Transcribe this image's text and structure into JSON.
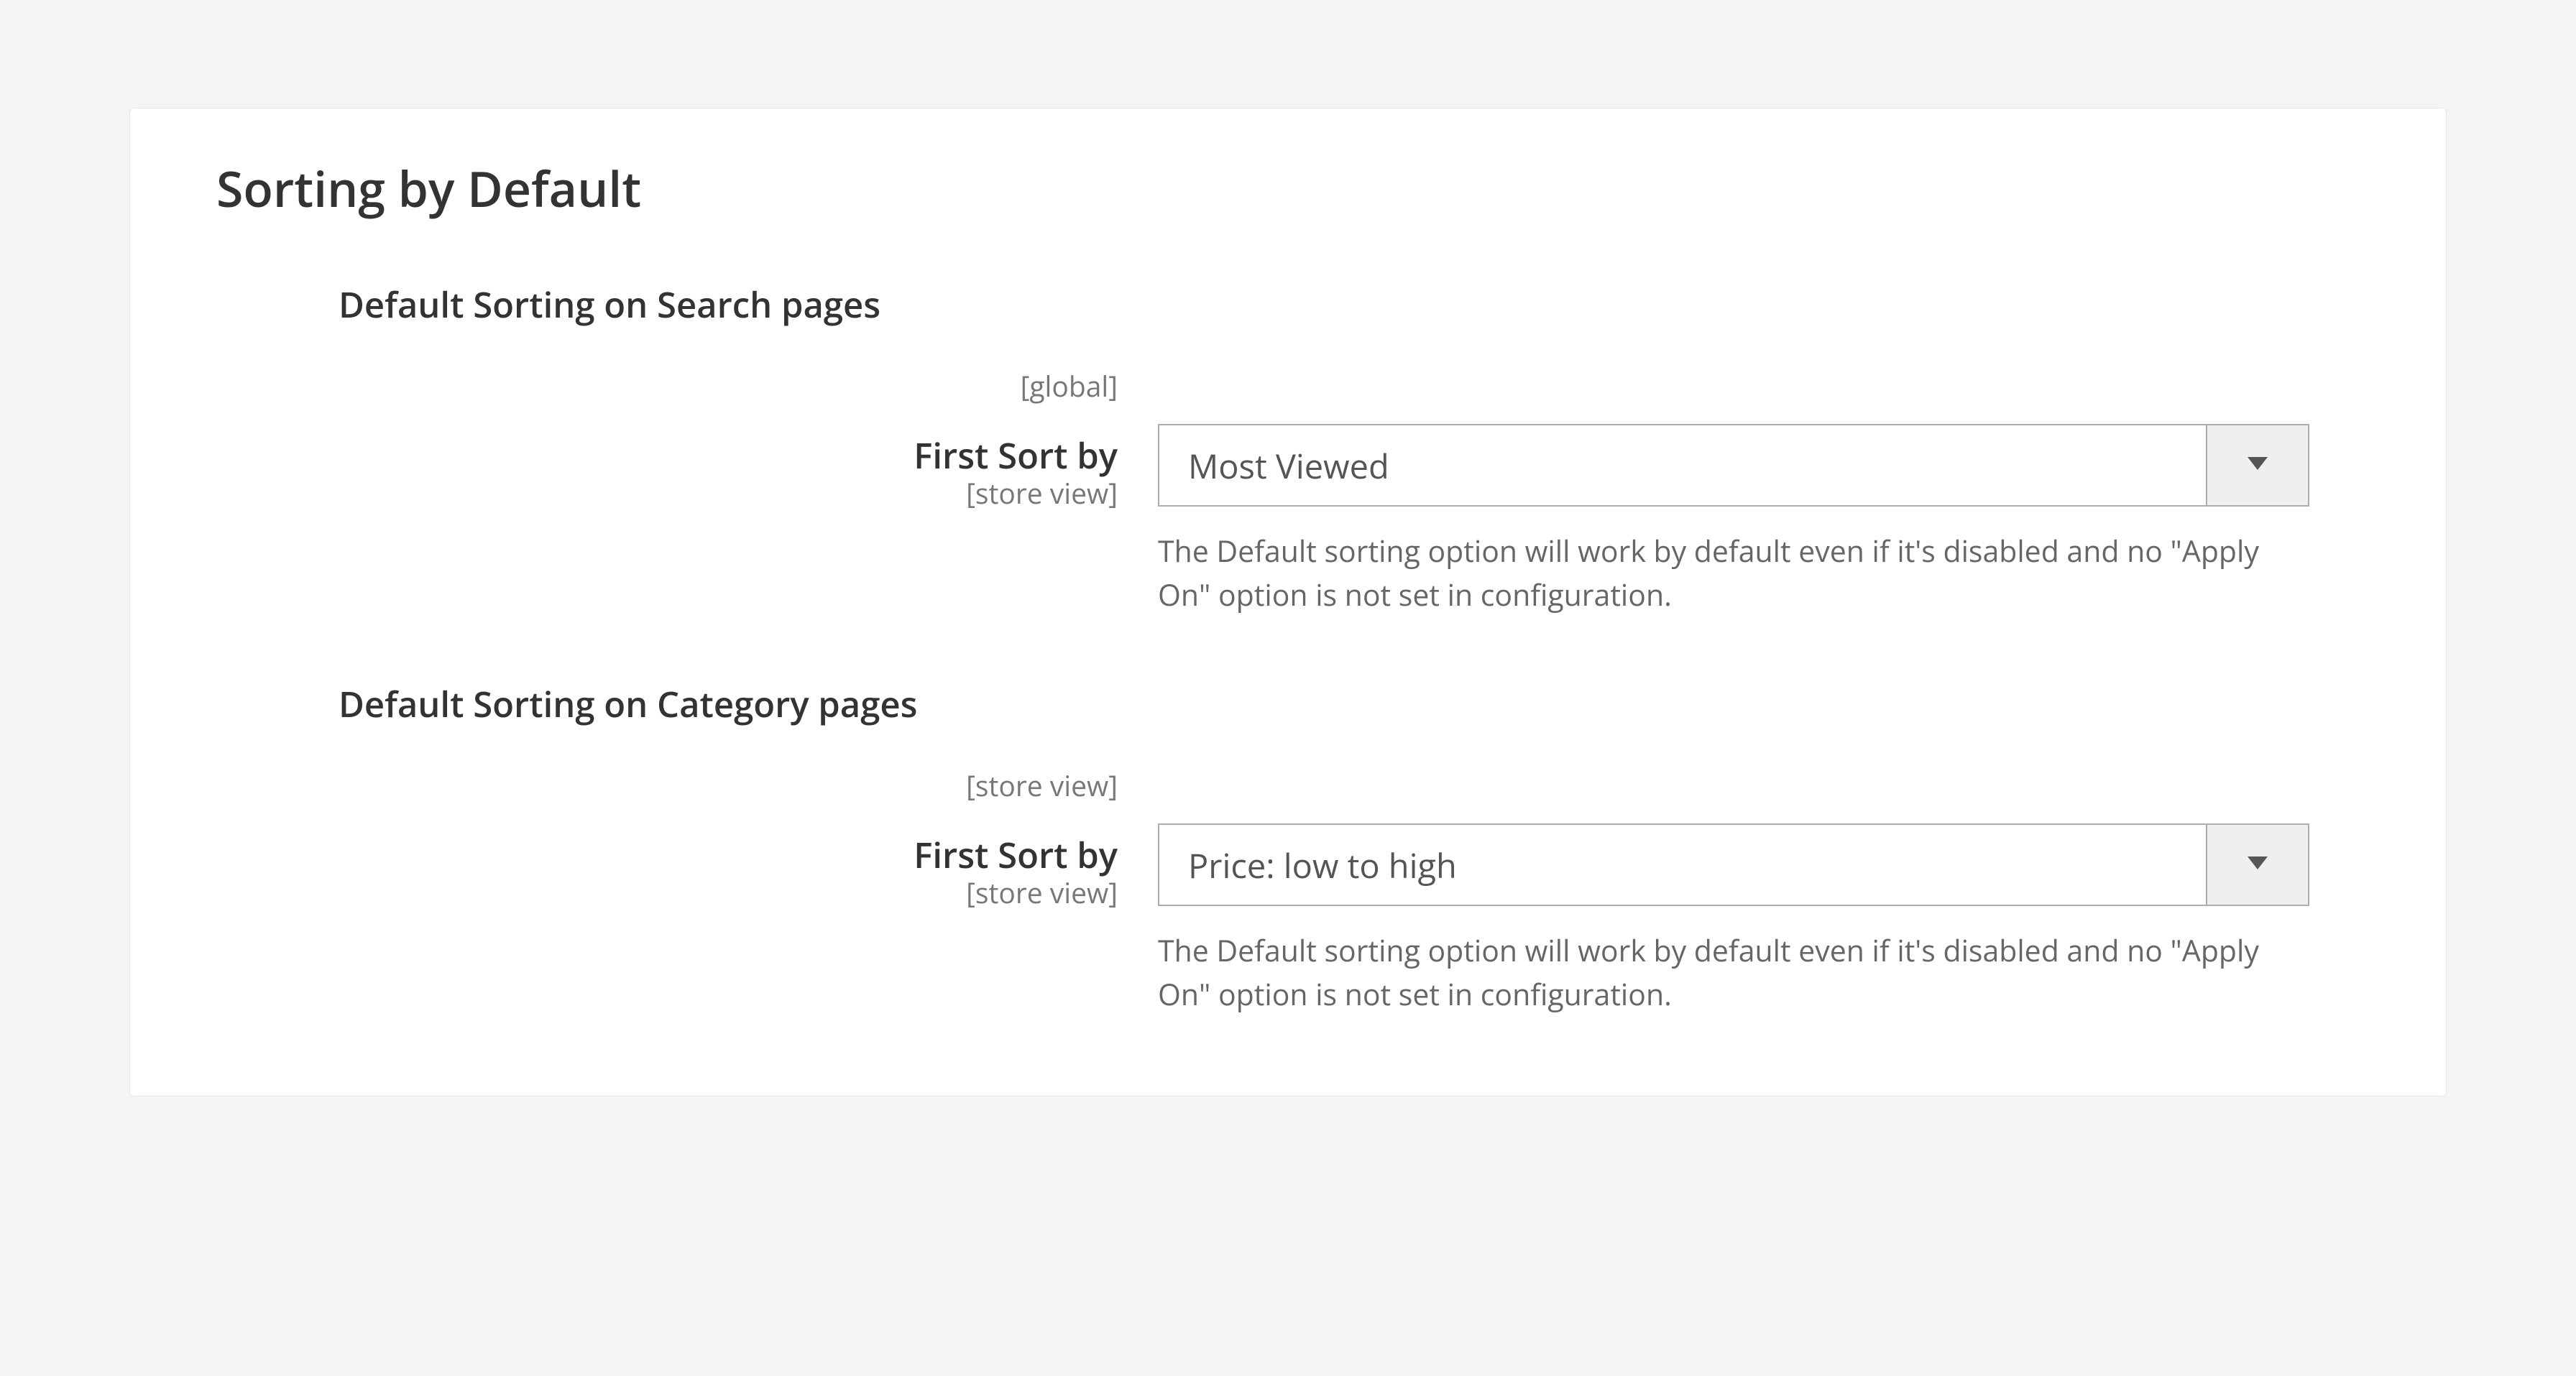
{
  "section": {
    "title": "Sorting by Default"
  },
  "groups": {
    "search": {
      "heading": "Default Sorting on Search pages",
      "scope": "[global]",
      "field": {
        "label": "First Sort by",
        "scope": "[store view]",
        "value": "Most Viewed",
        "help": "The Default sorting option will work by default even if it's disabled and no \"Apply On\" option is not set in configuration."
      }
    },
    "category": {
      "heading": "Default Sorting on Category pages",
      "scope": "[store view]",
      "field": {
        "label": "First Sort by",
        "scope": "[store view]",
        "value": "Price: low to high",
        "help": "The Default sorting option will work by default even if it's disabled and no \"Apply On\" option is not set in configuration."
      }
    }
  }
}
